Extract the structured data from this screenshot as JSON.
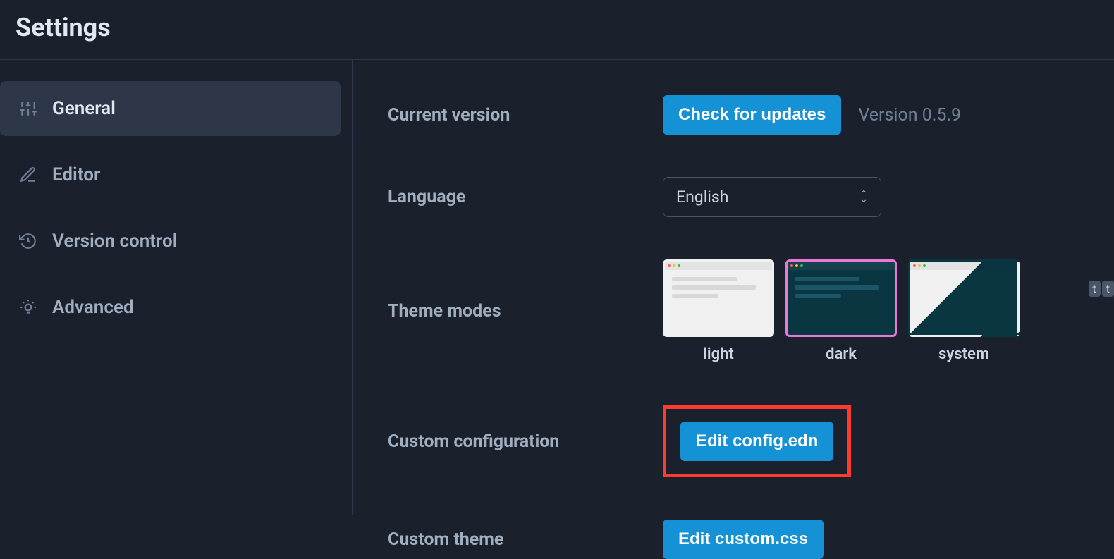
{
  "header": {
    "title": "Settings"
  },
  "sidebar": {
    "items": [
      {
        "label": "General",
        "active": true
      },
      {
        "label": "Editor",
        "active": false
      },
      {
        "label": "Version control",
        "active": false
      },
      {
        "label": "Advanced",
        "active": false
      }
    ]
  },
  "settings": {
    "version": {
      "label": "Current version",
      "check_button": "Check for updates",
      "version_text": "Version 0.5.9"
    },
    "language": {
      "label": "Language",
      "selected": "English"
    },
    "theme": {
      "label": "Theme modes",
      "options": [
        {
          "label": "light"
        },
        {
          "label": "dark"
        },
        {
          "label": "system"
        }
      ],
      "selected": "dark"
    },
    "custom_config": {
      "label": "Custom configuration",
      "button": "Edit config.edn"
    },
    "custom_theme": {
      "label": "Custom theme",
      "button": "Edit custom.css"
    }
  },
  "badges": {
    "t1": "t",
    "t2": "t"
  }
}
